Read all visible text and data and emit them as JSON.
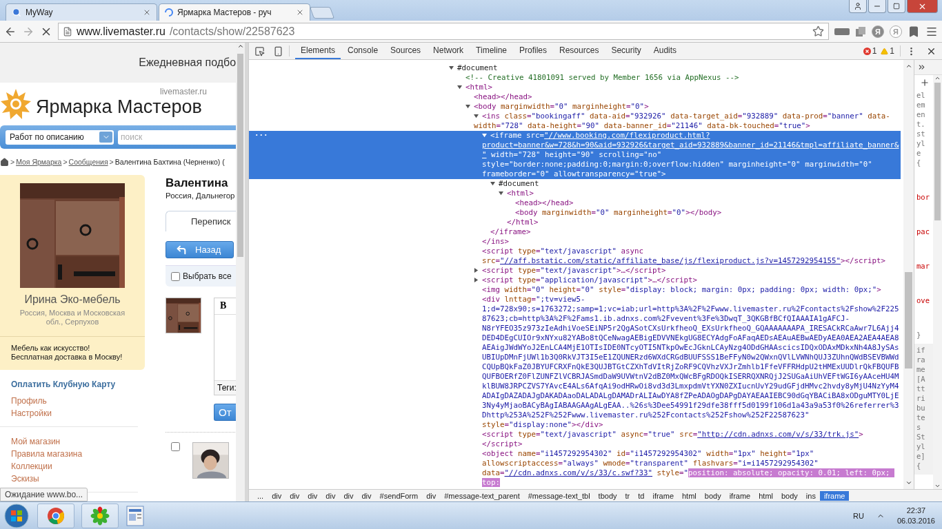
{
  "browser": {
    "tabs": [
      {
        "title": "MyWay",
        "selected": false
      },
      {
        "title": "Ярмарка Мастеров - руч",
        "selected": true
      }
    ],
    "url": {
      "host": "www.livemaster.ru",
      "path": "/contacts/show/22587623"
    },
    "extension_letters": [
      "Я",
      "Я"
    ]
  },
  "page": {
    "banner": "Ежедневная подбо",
    "logo": {
      "name": "Ярмарка Мастеров",
      "domain": "livemaster.ru"
    },
    "search": {
      "category": "Работ по описанию",
      "placeholder": "поиск"
    },
    "breadcrumbs": [
      {
        "sep": ">",
        "label": "Моя Ярмарка",
        "link": true
      },
      {
        "sep": ">",
        "label": "Сообщения",
        "link": true
      },
      {
        "sep": ">",
        "label": "Валентина Бахтина (Черненко) (",
        "link": false
      }
    ],
    "shop_card": {
      "name": "Ирина Эко-мебель",
      "location": "Россия, Москва и Московская обл., Серпухов",
      "slogan": [
        "Мебель как искусство!",
        "Бесплатная доставка в Москву!"
      ]
    },
    "menu": [
      [
        {
          "label": "Оплатить Клубную Карту",
          "kind": "primary"
        },
        {
          "label": "Профиль",
          "kind": "link"
        },
        {
          "label": "Настройки",
          "kind": "link"
        }
      ],
      [
        {
          "label": "Мой магазин",
          "kind": "link"
        },
        {
          "label": "Правила магазина",
          "kind": "link"
        },
        {
          "label": "Коллекции",
          "kind": "link"
        },
        {
          "label": "Эскизы",
          "kind": "link"
        }
      ]
    ],
    "contact": {
      "name": "Валентина",
      "location": "Россия, Дальнегор"
    },
    "tab": "Переписк",
    "back_button": "Назад",
    "select_all": {
      "label": "Выбрать все",
      "checked": false
    },
    "editor": {
      "bold_button": "B",
      "tags_label": "Теги:"
    },
    "send_button": "От",
    "message_checkbox": {
      "checked": false
    }
  },
  "status_bubble": "Ожидание www.bo...",
  "devtools": {
    "tabs": [
      {
        "label": "Elements",
        "selected": true
      },
      {
        "label": "Console",
        "selected": false
      },
      {
        "label": "Sources",
        "selected": false
      },
      {
        "label": "Network",
        "selected": false
      },
      {
        "label": "Timeline",
        "selected": false
      },
      {
        "label": "Profiles",
        "selected": false
      },
      {
        "label": "Resources",
        "selected": false
      },
      {
        "label": "Security",
        "selected": false
      },
      {
        "label": "Audits",
        "selected": false
      }
    ],
    "errors": "1",
    "warnings": "1",
    "selection_dots": "···",
    "tree": [
      {
        "text": "#document",
        "expanded": true,
        "selected": false,
        "children": [
          {
            "text": "<!-- Creative 41801091 served by Member 1656 via AppNexus -->",
            "selected": false
          },
          {
            "text": "<html>",
            "expanded": true,
            "selected": false,
            "children": [
              {
                "text": "<head></head>",
                "selected": false
              },
              {
                "text": "<body marginwidth=\"0\" marginheight=\"0\">",
                "expanded": true,
                "selected": false,
                "children": [
                  {
                    "text": "<ins class=\"bookingaff\" data-aid=\"932926\" data-target_aid=\"932889\" data-prod=\"banner\" data-width=\"728\" data-height=\"90\" data-banner_id=\"21146\" data-bk-touched=\"true\">",
                    "expanded": true,
                    "selected": false,
                    "close": "</ins>",
                    "children": [
                      {
                        "text": "<iframe src=\"//www.booking.com/flexiproduct.html?product=banner&w=728&h=90&aid=932926&target_aid=932889&banner_id=21146&tmpl=affiliate_banner&\" width=\"728\" height=\"90\" scrolling=\"no\" style=\"border:none;padding:0;margin:0;overflow:hidden\" marginheight=\"0\" marginwidth=\"0\" frameborder=\"0\" allowtransparency=\"true\">",
                        "expanded": true,
                        "selected": true,
                        "close": "</iframe>",
                        "children": [
                          {
                            "text": "#document",
                            "expanded": true,
                            "selected": false,
                            "children": [
                              {
                                "text": "<html>",
                                "expanded": true,
                                "selected": false,
                                "close": "</html>",
                                "children": [
                                  {
                                    "text": "<head></head>",
                                    "selected": false
                                  },
                                  {
                                    "text": "<body marginwidth=\"0\" marginheight=\"0\"></body>",
                                    "selected": false
                                  }
                                ]
                              }
                            ]
                          }
                        ]
                      }
                    ]
                  },
                  {
                    "text": "<script type=\"text/javascript\" async src=\"//aff.bstatic.com/static/affiliate_base/js/flexiproduct.js?v=1457292954155\"></script>",
                    "selected": false
                  },
                  {
                    "text": "<script type=\"text/javascript\">…</script>",
                    "expanded": false,
                    "selected": false
                  },
                  {
                    "text": "<script type=\"application/javascript\">…</script>",
                    "expanded": false,
                    "selected": false
                  },
                  {
                    "text": "<img width=\"0\" height=\"0\" style=\"display: block; margin: 0px; padding: 0px; width: 0px;\">",
                    "selected": false
                  },
                  {
                    "text": "<div lnttag=\";tv=view5-1;d=728x90;s=1763272;samp=1;vc=iab;url=http%3A%2F%2Fwww.livemaster.ru%2Fcontacts%2Fshow%2F22587623;cb=http%3A%2F%2Fams1.ib.adnxs.com%2Fvevent%3Fe%3DwqT_3QKGBfBCfQIAAAIA1gAFCJ-N8rYFEO35z973zIeAdhiVoeSEiNP5r2QgASotCXsUrkfheoQ_EXsUrkfheoQ_GQAAAAAAAPA_IRESACkRCaAwr7L6Ajj4DED4DEgCUIOr9xNYxu82YABo8tQCeNwagAEBigEDVVNEkgUG8ECYAdgFoAFaqAEDsAEAuAEBwAEDyAEA0AEA2AEA4AEA8AEAigJWdWYoJ2EnLCA4MjE1OTIsIDE0NTcyOTI5NTkpOwEcJGknLCAyNzg4ODdGHAAscicsIDQxODAxMDkxNh4A8JySAsUBIUpDMnFjUWl1b3Q0RkVJT3I5eE1ZQUNERzd6WXdCRGdBUUFSSS1BeFFyN0w2QWxnQVlLVWNhQUJ3ZUhnQWdBSEVBWWdCQUpBQkFaZ0JBYUFCRXFnQkE3QUJBTGtCZXhTdVItRjZoRF9CQVhzVXJrZmhlb1FfeVFFRHdpU2tHMExUUDlrQkFBQUFBQUFBOERfZ0FlZUNFZlVCBRJASmdDaW9UVWtnV2dBZ0MxQWcBFgRDOQkISERRQXNRQjJ2SUGaAiUhVEFtWGI6yAAceHU4MklBUW8JRPCZVS7YAvcE4ALs6AfqAi9odHRwOi8vd3d3LmxpdmVtYXN0ZXIucnUvY29udGFjdHMvc2hvdy8yMjU4NzYyM4ADAIgDAZADAJgDAKADAaoDALADALgDAMADrALIAwDYA8fZPeADAOgDAPgDAYAEAAIEBC90dGqYBACiBA8xODguMTY0LjE3Ny4yMjaoBACyBAgIABAAGAAgALgEAA..%26s%3Dee54991f29dfe38fff5d0199f106d1a43a9a53f0%26referrer%3Dhttp%253A%252F%252Fwww.livemaster.ru%252Fcontacts%252Fshow%252F22587623\" style=\"display:none\"></div>",
                    "selected": false
                  },
                  {
                    "text": "<script type=\"text/javascript\" async=\"true\" src=\"http://cdn.adnxs.com/v/s/33/trk.js\"></script>",
                    "selected": false
                  },
                  {
                    "text": "<object name=\"i1457292954302\" id=\"i1457292954302\" width=\"1px\" height=\"1px\" allowscriptaccess=\"always\" wmode=\"transparent\" flashvars=\"i=i1457292954302\" data=\"//cdn.adnxs.com/v/s/33/c.swf?33\" style=\"",
                    "match": "position: absolute; opacity: 0.01; left: 0px; top:",
                    "selected": false
                  }
                ]
              }
            ]
          }
        ]
      }
    ],
    "styles": [
      {
        "kind": "inline",
        "selector": "element.style {",
        "props": [
          "bor",
          "pac",
          "mar",
          "ove"
        ],
        "end": "}"
      },
      {
        "kind": "attributes",
        "selector": "iframe[Attributes Style] {"
      }
    ],
    "breadcrumbs": [
      {
        "label": "...",
        "selected": false
      },
      {
        "label": "div",
        "selected": false
      },
      {
        "label": "div",
        "selected": false
      },
      {
        "label": "div",
        "selected": false
      },
      {
        "label": "div",
        "selected": false
      },
      {
        "label": "div",
        "selected": false
      },
      {
        "label": "div",
        "selected": false
      },
      {
        "label": "#sendForm",
        "selected": false
      },
      {
        "label": "div",
        "selected": false
      },
      {
        "label": "#message-text_parent",
        "selected": false
      },
      {
        "label": "#message-text_tbl",
        "selected": false
      },
      {
        "label": "tbody",
        "selected": false
      },
      {
        "label": "tr",
        "selected": false
      },
      {
        "label": "td",
        "selected": false
      },
      {
        "label": "iframe",
        "selected": false
      },
      {
        "label": "html",
        "selected": false
      },
      {
        "label": "body",
        "selected": false
      },
      {
        "label": "iframe",
        "selected": false
      },
      {
        "label": "html",
        "selected": false
      },
      {
        "label": "body",
        "selected": false
      },
      {
        "label": "ins",
        "selected": false
      },
      {
        "label": "iframe",
        "selected": true
      }
    ]
  },
  "taskbar": {
    "language": "RU",
    "time": "22:37",
    "date": "06.03.2016"
  }
}
